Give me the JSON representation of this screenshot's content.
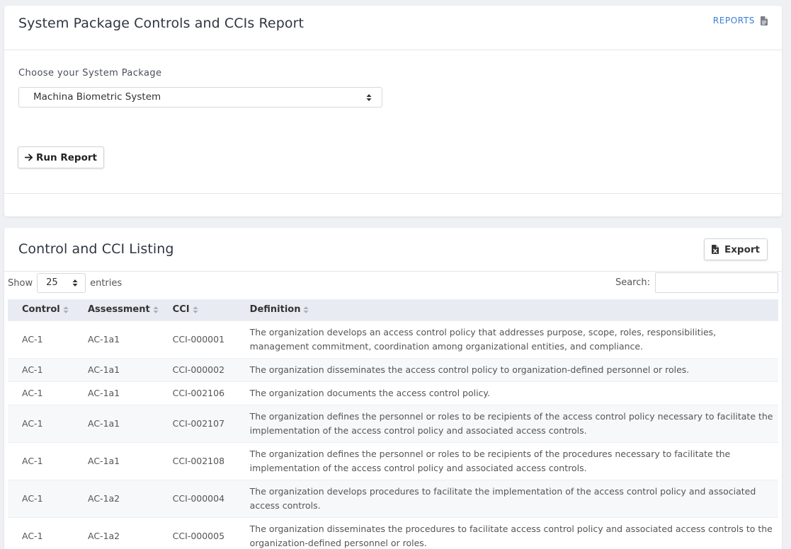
{
  "report_card": {
    "title": "System Package Controls and CCIs Report",
    "reports_link": "REPORTS",
    "reports_icon": "document-icon",
    "package_label": "Choose your System Package",
    "package_selected": "Machina Biometric System",
    "run_button": "Run Report"
  },
  "listing_card": {
    "title": "Control and CCI Listing",
    "export_button": "Export",
    "export_icon": "excel-file-icon",
    "show_label": "Show",
    "entries_value": "25",
    "entries_label": "entries",
    "search_label": "Search:",
    "search_value": ""
  },
  "table": {
    "headers": [
      "Control",
      "Assessment",
      "CCI",
      "Definition"
    ],
    "rows": [
      {
        "control": "AC-1",
        "assessment": "AC-1a1",
        "cci": "CCI-000001",
        "definition": "The organization develops an access control policy that addresses purpose, scope, roles, responsibilities, management commitment, coordination among organizational entities, and compliance."
      },
      {
        "control": "AC-1",
        "assessment": "AC-1a1",
        "cci": "CCI-000002",
        "definition": "The organization disseminates the access control policy to organization-defined personnel or roles."
      },
      {
        "control": "AC-1",
        "assessment": "AC-1a1",
        "cci": "CCI-002106",
        "definition": "The organization documents the access control policy."
      },
      {
        "control": "AC-1",
        "assessment": "AC-1a1",
        "cci": "CCI-002107",
        "definition": "The organization defines the personnel or roles to be recipients of the access control policy necessary to facilitate the implementation of the access control policy and associated access controls."
      },
      {
        "control": "AC-1",
        "assessment": "AC-1a1",
        "cci": "CCI-002108",
        "definition": "The organization defines the personnel or roles to be recipients of the procedures necessary to facilitate the implementation of the access control policy and associated access controls."
      },
      {
        "control": "AC-1",
        "assessment": "AC-1a2",
        "cci": "CCI-000004",
        "definition": "The organization develops procedures to facilitate the implementation of the access control policy and associated access controls."
      },
      {
        "control": "AC-1",
        "assessment": "AC-1a2",
        "cci": "CCI-000005",
        "definition": "The organization disseminates the procedures to facilitate access control policy and associated access controls to the organization-defined personnel or roles."
      }
    ]
  },
  "colors": {
    "accent": "#3a7bd5",
    "header_bg": "#e8ecf2",
    "page_bg": "#eef0f4"
  }
}
